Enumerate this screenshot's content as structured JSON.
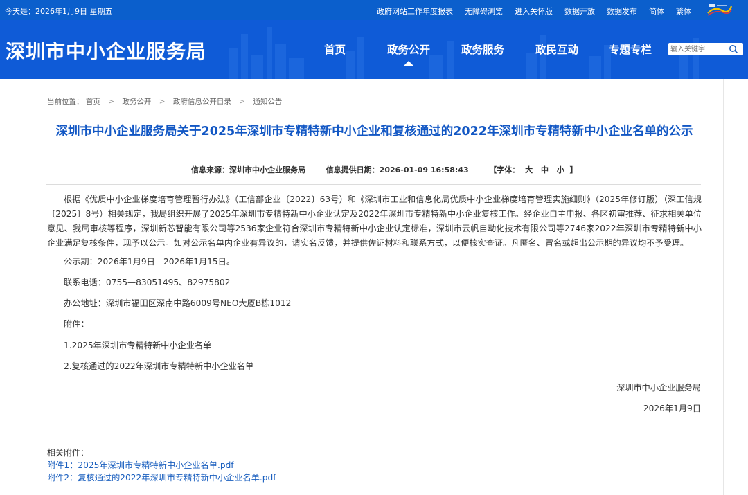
{
  "topbar": {
    "date": "今天是：2026年1月9日 星期五",
    "links": [
      "政府网站工作年度报表",
      "无障碍浏览",
      "进入关怀版",
      "数据开放",
      "数据发布",
      "简体",
      "繁体"
    ]
  },
  "header": {
    "site_title": "深圳市中小企业服务局",
    "nav": [
      "首页",
      "政务公开",
      "政务服务",
      "政民互动",
      "专题专栏"
    ],
    "active_nav": "政务公开",
    "search_placeholder": "输入关键字"
  },
  "breadcrumb": {
    "label": "当前位置：",
    "items": [
      "首页",
      "政务公开",
      "政府信息公开目录",
      "通知公告"
    ]
  },
  "article": {
    "title": "深圳市中小企业服务局关于2025年深圳市专精特新中小企业和复核通过的2022年深圳市专精特新中小企业名单的公示",
    "source_label": "信息来源：",
    "source": "深圳市中小企业服务局",
    "date_label": "信息提供日期：",
    "date": "2026-01-09 16:58:43",
    "font_label": "【字体：",
    "font_sizes": [
      "大",
      "中",
      "小"
    ],
    "font_close": "】",
    "body": "根据《优质中小企业梯度培育管理暂行办法》（工信部企业〔2022〕63号）和《深圳市工业和信息化局优质中小企业梯度培育管理实施细则》（2025年修订版）（深工信规〔2025〕8号）相关规定，我局组织开展了2025年深圳市专精特新中小企业认定及2022年深圳市专精特新中小企业复核工作。经企业自主申报、各区初审推荐、征求相关单位意见、我局审核等程序，深圳新芯智能有限公司等2536家企业符合深圳市专精特新中小企业认定标准，深圳市云帆自动化技术有限公司等2746家2022年深圳市专精特新中小企业满足复核条件，现予以公示。如对公示名单内企业有异议的，请实名反馈，并提供佐证材料和联系方式，以便核实查证。凡匿名、冒名或超出公示期的异议均不予受理。",
    "period": "公示期：2026年1月9日—2026年1月15日。",
    "phone": "联系电话：0755—83051495、82975802",
    "address": "办公地址：深圳市福田区深南中路6009号NEO大厦B栋1012",
    "attach_label": "附件：",
    "attachments": [
      "1.2025年深圳市专精特新中小企业名单",
      "2.复核通过的2022年深圳市专精特新中小企业名单"
    ],
    "signature": "深圳市中小企业服务局",
    "sign_date": "2026年1月9日"
  },
  "related": {
    "label": "相关附件：",
    "links": [
      "附件1：2025年深圳市专精特新中小企业名单.pdf",
      "附件2：复核通过的2022年深圳市专精特新中小企业名单.pdf"
    ]
  }
}
